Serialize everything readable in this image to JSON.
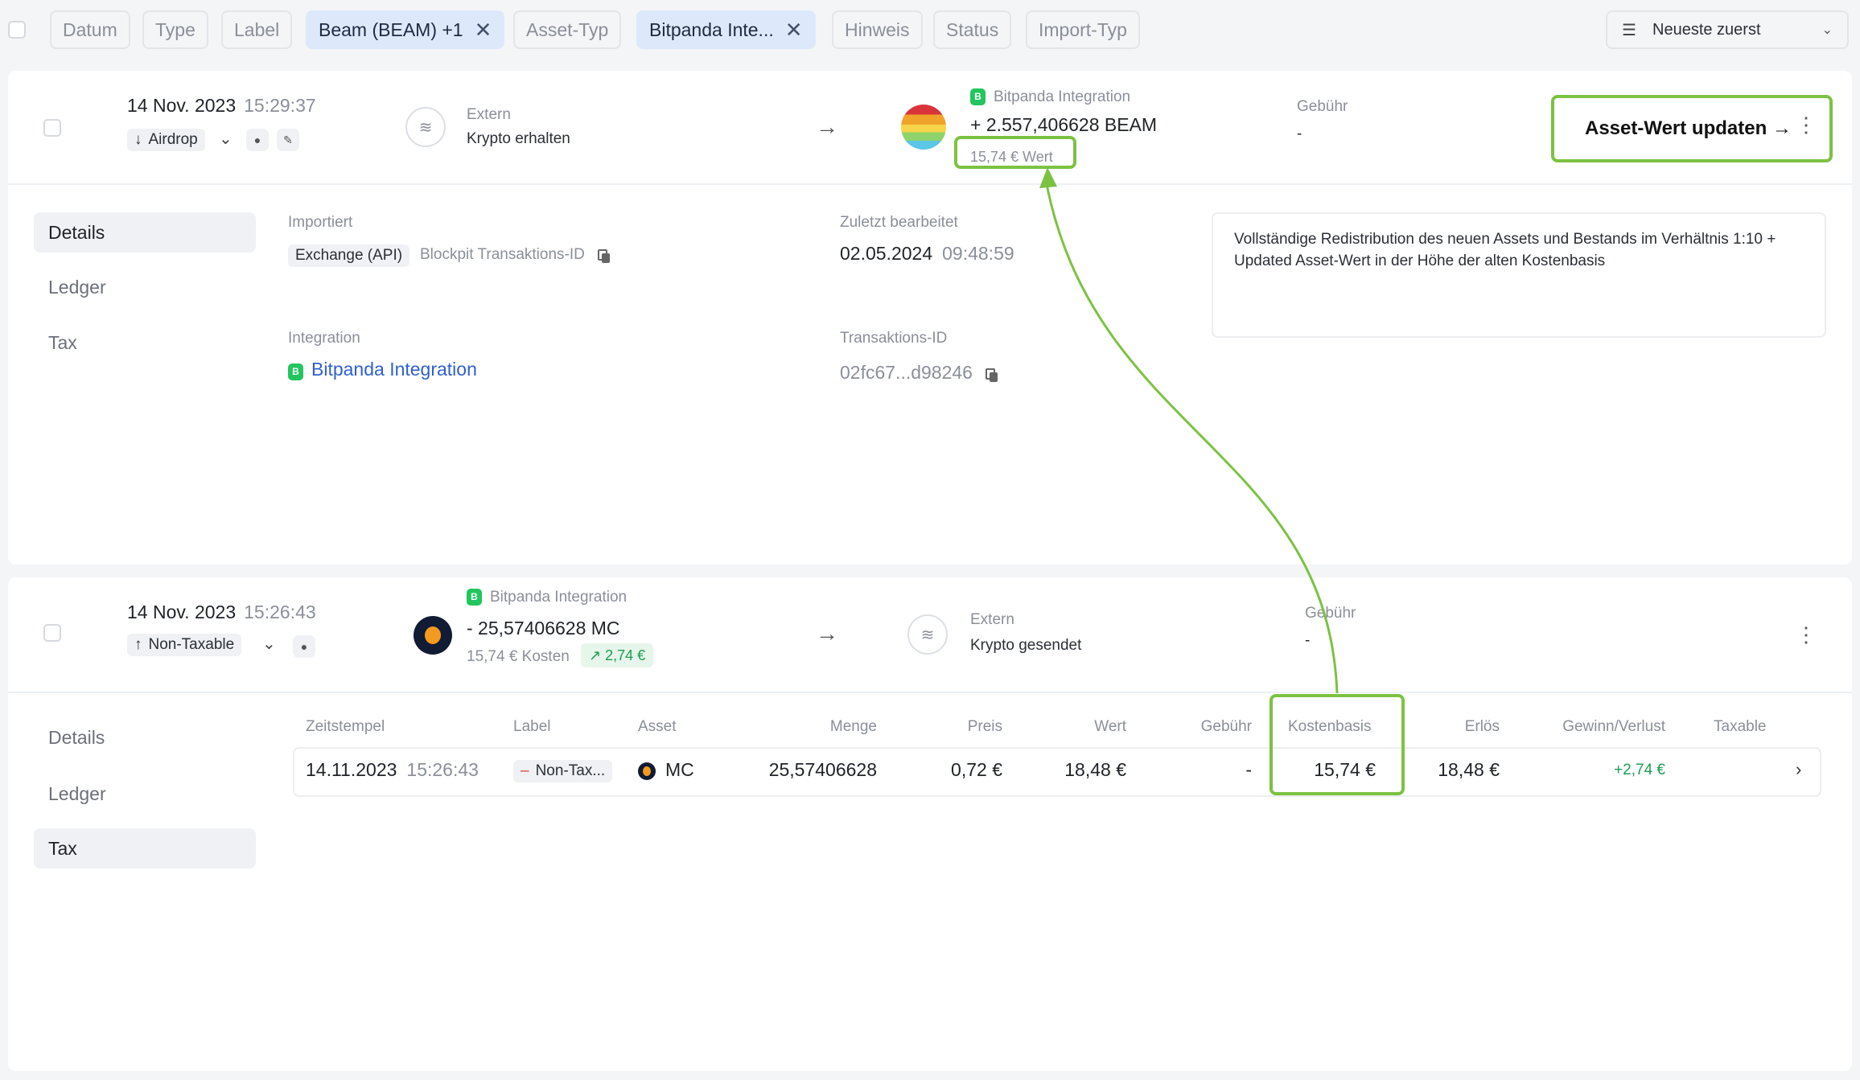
{
  "filters": {
    "chips": [
      {
        "label": "Datum"
      },
      {
        "label": "Type"
      },
      {
        "label": "Label"
      },
      {
        "label": "Beam (BEAM) +1",
        "active": true
      },
      {
        "label": "Asset-Typ"
      },
      {
        "label": "Bitpanda Inte...",
        "active": true
      },
      {
        "label": "Hinweis"
      },
      {
        "label": "Status"
      },
      {
        "label": "Import-Typ"
      }
    ],
    "sort_label": "Neueste zuerst"
  },
  "tx1": {
    "date": "14 Nov. 2023",
    "time": "15:29:37",
    "type_tag": "Airdrop",
    "from_label": "Extern",
    "from_sub": "Krypto erhalten",
    "to_source": "Bitpanda Integration",
    "amount": "+ 2.557,406628 BEAM",
    "value": "15,74 € Wert",
    "fee_label": "Gebühr",
    "fee_value": "-",
    "callout": "Asset-Wert updaten →",
    "tabs": [
      "Details",
      "Ledger",
      "Tax"
    ],
    "details": {
      "imported_label": "Importiert",
      "imported_tag": "Exchange (API)",
      "imported_id_label": "Blockpit Transaktions-ID",
      "edited_label": "Zuletzt bearbeitet",
      "edited_date": "02.05.2024",
      "edited_time": "09:48:59",
      "integration_label": "Integration",
      "integration_value": "Bitpanda Integration",
      "txid_label": "Transaktions-ID",
      "txid_value": "02fc67...d98246",
      "note": "Vollständige Redistribution des neuen Assets und Bestands im Verhältnis 1:10 + Updated Asset-Wert in der Höhe der alten Kostenbasis"
    }
  },
  "tx2": {
    "date": "14 Nov. 2023",
    "time": "15:26:43",
    "type_tag": "Non-Taxable",
    "from_source": "Bitpanda Integration",
    "amount": "- 25,57406628 MC",
    "cost": "15,74 € Kosten",
    "gain_badge": "↗ 2,74 €",
    "to_label": "Extern",
    "to_sub": "Krypto gesendet",
    "fee_label": "Gebühr",
    "fee_value": "-",
    "tabs": [
      "Details",
      "Ledger",
      "Tax"
    ],
    "tax_table": {
      "headers": [
        "Zeitstempel",
        "Label",
        "Asset",
        "Menge",
        "Preis",
        "Wert",
        "Gebühr",
        "Kostenbasis",
        "Erlös",
        "Gewinn/Verlust",
        "Taxable"
      ],
      "row": {
        "date": "14.11.2023",
        "time": "15:26:43",
        "label": "Non-Tax...",
        "asset": "MC",
        "menge": "25,57406628",
        "preis": "0,72 €",
        "wert": "18,48 €",
        "gebuehr": "-",
        "kostenbasis": "15,74 €",
        "erloes": "18,48 €",
        "gewinn": "+2,74 €"
      }
    }
  },
  "colors": {
    "highlight_green": "#7cc242",
    "active_chip": "#dde9fb",
    "link_blue": "#2f5fd0",
    "bitpanda_green": "#22c55e"
  }
}
